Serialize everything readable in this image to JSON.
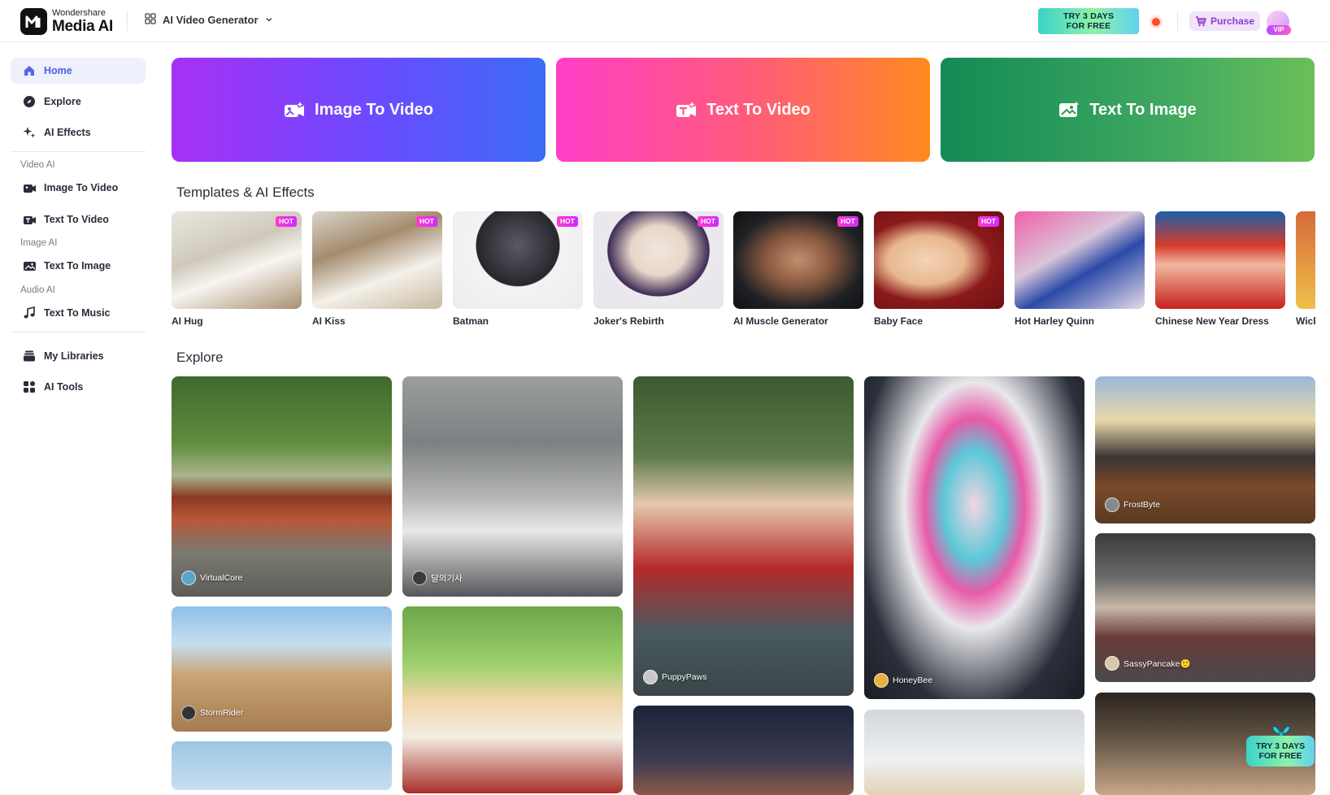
{
  "header": {
    "brand_top": "Wondershare",
    "brand_name": "Media AI",
    "tool_switch_label": "AI Video Generator",
    "trial_line1": "TRY 3 DAYS",
    "trial_line2_for": "FOR ",
    "trial_line2_free": "FREE",
    "purchase_label": "Purchase",
    "vip_label": "VIP"
  },
  "sidebar": {
    "home": "Home",
    "explore": "Explore",
    "ai_effects": "AI Effects",
    "section_video": "Video AI",
    "image_to_video": "Image To Video",
    "text_to_video": "Text To Video",
    "section_image": "Image AI",
    "text_to_image": "Text To Image",
    "section_audio": "Audio AI",
    "text_to_music": "Text To Music",
    "my_libraries": "My Libraries",
    "ai_tools": "AI Tools"
  },
  "hero": [
    {
      "label": "Image To Video"
    },
    {
      "label": "Text To Video"
    },
    {
      "label": "Text To Image"
    }
  ],
  "templates_title": "Templates & AI Effects",
  "templates": [
    {
      "name": "AI Hug",
      "hot": "HOT"
    },
    {
      "name": "AI Kiss",
      "hot": "HOT"
    },
    {
      "name": "Batman",
      "hot": "HOT"
    },
    {
      "name": "Joker's Rebirth",
      "hot": "HOT"
    },
    {
      "name": "AI Muscle Generator",
      "hot": "HOT"
    },
    {
      "name": "Baby Face",
      "hot": "HOT"
    },
    {
      "name": "Hot Harley Quinn",
      "hot": ""
    },
    {
      "name": "Chinese New Year Dress",
      "hot": ""
    },
    {
      "name": "Wick",
      "hot": ""
    }
  ],
  "explore_title": "Explore",
  "explore_cards": [
    {
      "user": "VirtualCore"
    },
    {
      "user": "달의기사"
    },
    {
      "user": "PuppyPaws"
    },
    {
      "user": "HoneyBee"
    },
    {
      "user": "FrostByte"
    },
    {
      "user": "SassyPancake🙂"
    },
    {
      "user": "StormRider"
    }
  ],
  "float_promo": {
    "line1": "TRY 3 DAYS",
    "line2_for": "FOR ",
    "line2_free": "FREE"
  }
}
